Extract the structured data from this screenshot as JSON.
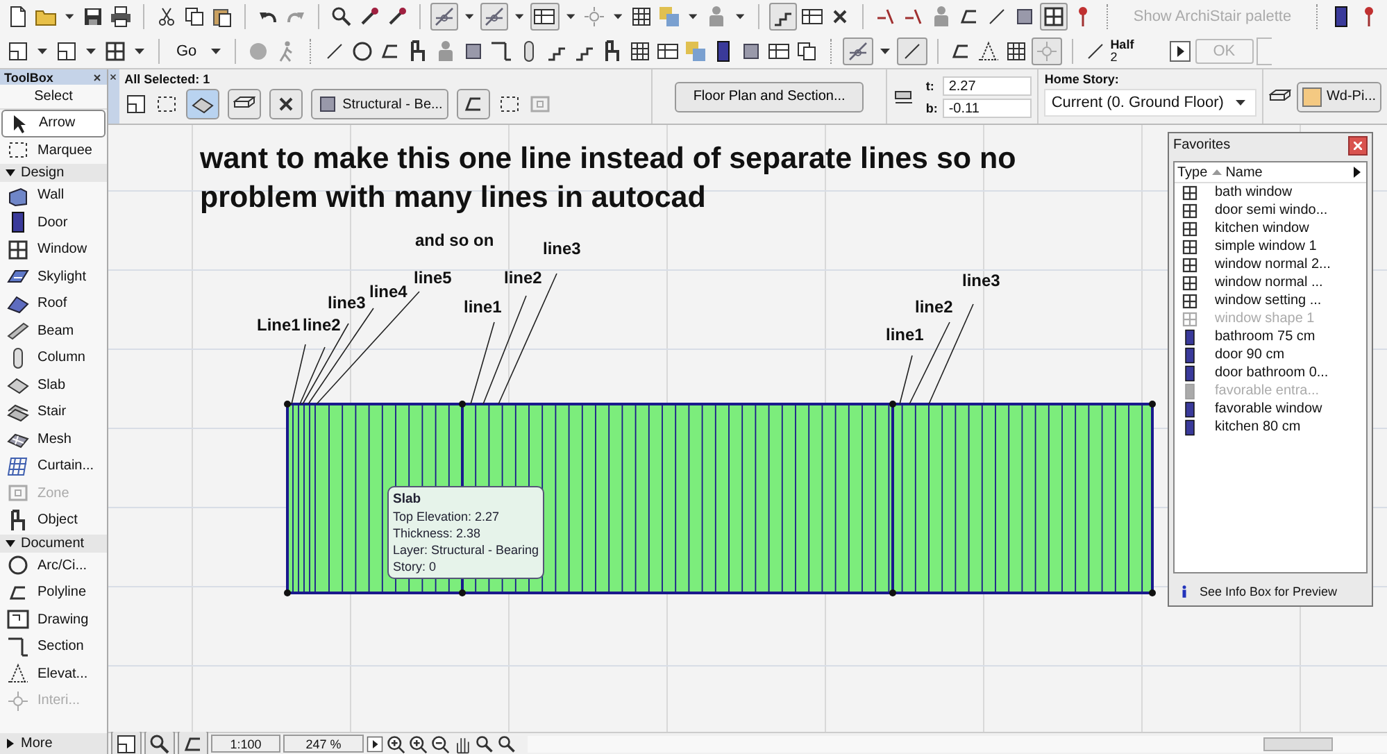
{
  "toolbar": {
    "go_label": "Go",
    "archistair_button": "Show ArchiStair palette",
    "half_label": "Half",
    "half_value": "2",
    "ok_button": "OK"
  },
  "toolbox": {
    "title": "ToolBox",
    "items": [
      {
        "kind": "label",
        "label": "Select"
      },
      {
        "kind": "tool",
        "label": "Arrow",
        "selected": true,
        "disabled": false
      },
      {
        "kind": "tool",
        "label": "Marquee",
        "selected": false,
        "disabled": false
      },
      {
        "kind": "header",
        "label": "Design",
        "expanded": true
      },
      {
        "kind": "tool",
        "label": "Wall",
        "selected": false,
        "disabled": false
      },
      {
        "kind": "tool",
        "label": "Door",
        "selected": false,
        "disabled": false
      },
      {
        "kind": "tool",
        "label": "Window",
        "selected": false,
        "disabled": false
      },
      {
        "kind": "tool",
        "label": "Skylight",
        "selected": false,
        "disabled": false
      },
      {
        "kind": "tool",
        "label": "Roof",
        "selected": false,
        "disabled": false
      },
      {
        "kind": "tool",
        "label": "Beam",
        "selected": false,
        "disabled": false
      },
      {
        "kind": "tool",
        "label": "Column",
        "selected": false,
        "disabled": false
      },
      {
        "kind": "tool",
        "label": "Slab",
        "selected": false,
        "disabled": false
      },
      {
        "kind": "tool",
        "label": "Stair",
        "selected": false,
        "disabled": false
      },
      {
        "kind": "tool",
        "label": "Mesh",
        "selected": false,
        "disabled": false
      },
      {
        "kind": "tool",
        "label": "Curtain...",
        "selected": false,
        "disabled": false
      },
      {
        "kind": "tool",
        "label": "Zone",
        "selected": false,
        "disabled": true
      },
      {
        "kind": "tool",
        "label": "Object",
        "selected": false,
        "disabled": false
      },
      {
        "kind": "header",
        "label": "Document",
        "expanded": true
      },
      {
        "kind": "tool",
        "label": "Arc/Ci...",
        "selected": false,
        "disabled": false
      },
      {
        "kind": "tool",
        "label": "Polyline",
        "selected": false,
        "disabled": false
      },
      {
        "kind": "tool",
        "label": "Drawing",
        "selected": false,
        "disabled": false
      },
      {
        "kind": "tool",
        "label": "Section",
        "selected": false,
        "disabled": false
      },
      {
        "kind": "tool",
        "label": "Elevat...",
        "selected": false,
        "disabled": false
      },
      {
        "kind": "tool",
        "label": "Interi...",
        "selected": false,
        "disabled": true
      },
      {
        "kind": "header",
        "label": "More",
        "expanded": false
      }
    ]
  },
  "info_box": {
    "title": "All Selected: 1",
    "layer": "Structural - Be...",
    "floor_plan_button": "Floor Plan and Section...",
    "top_label": "t:",
    "top_value": "2.27",
    "bottom_label": "b:",
    "bottom_value": "-0.11",
    "home_story_label": "Home Story:",
    "home_story_value": "Current (0. Ground Floor)",
    "material": "Wd-Pi..."
  },
  "canvas": {
    "heading": "want to make this one line instead of separate lines so no problem with many lines in autocad",
    "annotations": [
      {
        "text": "and so on"
      },
      {
        "text": "Line1"
      },
      {
        "text": "line2"
      },
      {
        "text": "line3"
      },
      {
        "text": "line4"
      },
      {
        "text": "line5"
      },
      {
        "text": "line1"
      },
      {
        "text": "line2"
      },
      {
        "text": "line3"
      },
      {
        "text": "line1"
      },
      {
        "text": "line2"
      },
      {
        "text": "line3"
      }
    ],
    "tooltip": {
      "title": "Slab",
      "lines": [
        "Top Elevation: 2.27",
        "Thickness: 2.38",
        "Layer: Structural - Bearing",
        "Story: 0"
      ]
    }
  },
  "favorites": {
    "title": "Favorites",
    "columns": [
      "Type",
      "Name"
    ],
    "items": [
      {
        "kind": "window",
        "name": "bath window",
        "disabled": false
      },
      {
        "kind": "window",
        "name": "door semi windo...",
        "disabled": false
      },
      {
        "kind": "window",
        "name": "kitchen window",
        "disabled": false
      },
      {
        "kind": "window",
        "name": "simple window 1",
        "disabled": false
      },
      {
        "kind": "window",
        "name": "window normal 2...",
        "disabled": false
      },
      {
        "kind": "window",
        "name": "window normal ...",
        "disabled": false
      },
      {
        "kind": "window",
        "name": "window setting ...",
        "disabled": false
      },
      {
        "kind": "window",
        "name": "window shape 1",
        "disabled": true
      },
      {
        "kind": "door",
        "name": "bathroom 75 cm",
        "disabled": false
      },
      {
        "kind": "door",
        "name": "door 90 cm",
        "disabled": false
      },
      {
        "kind": "door",
        "name": "door bathroom 0...",
        "disabled": false
      },
      {
        "kind": "door",
        "name": "favorable entra...",
        "disabled": true
      },
      {
        "kind": "door",
        "name": "favorable window",
        "disabled": false
      },
      {
        "kind": "door",
        "name": "kitchen 80 cm",
        "disabled": false
      }
    ],
    "footer": "See Info Box for Preview"
  },
  "status_bar": {
    "scale": "1:100",
    "zoom": "247 %"
  }
}
